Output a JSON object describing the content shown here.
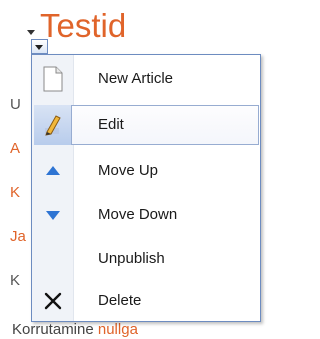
{
  "page": {
    "title": "Testid",
    "background_line_initials": [
      "U",
      "A",
      "K",
      "Ja",
      "K"
    ],
    "background_line_colors": [
      "#555555",
      "#e0642a",
      "#e0642a",
      "#e0642a",
      "#555555"
    ],
    "bottom_text": "Korrutamine",
    "bottom_link": "nullga"
  },
  "menu": {
    "selected_index": 1,
    "items": [
      {
        "label": "New Article",
        "icon": "new-document-icon"
      },
      {
        "label": "Edit",
        "icon": "edit-pencil-icon"
      },
      {
        "label": "Move Up",
        "icon": "move-up-icon"
      },
      {
        "label": "Move Down",
        "icon": "move-down-icon"
      },
      {
        "label": "Unpublish",
        "icon": ""
      },
      {
        "label": "Delete",
        "icon": "delete-x-icon"
      }
    ]
  },
  "colors": {
    "title": "#e0642a",
    "link": "#e0642a",
    "menu_border": "#6d8cc0",
    "up_down_icon": "#2e74d3"
  }
}
